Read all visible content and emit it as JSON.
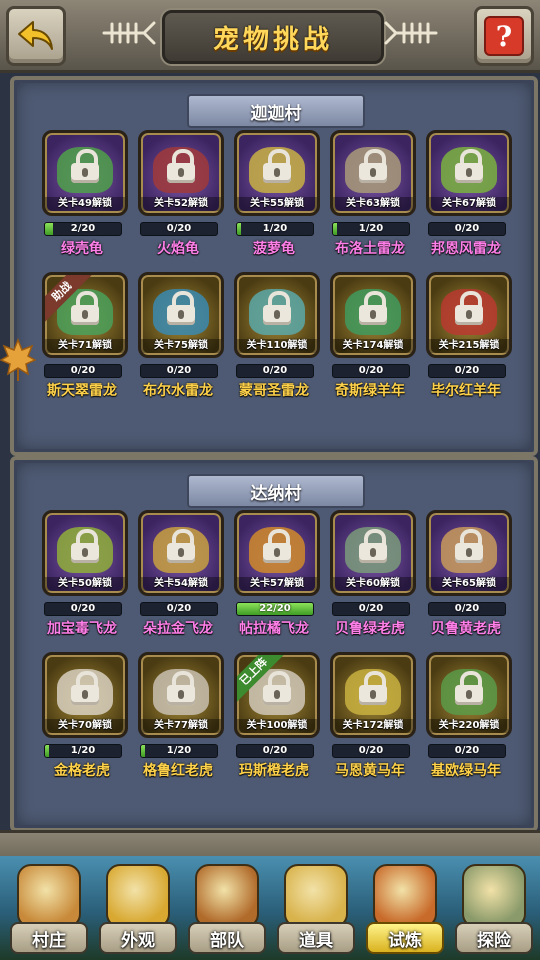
{
  "header": {
    "title": "宠物挑战",
    "help_glyph": "?"
  },
  "sections": [
    {
      "name": "迦迦村",
      "pets": [
        {
          "unlock": "关卡49解锁",
          "progress": "2/20",
          "fill": 0.1,
          "name": "绿壳龟",
          "name_color": "#ff7fe8",
          "card": "purple",
          "creature": "#4fa04a",
          "ribbon": ""
        },
        {
          "unlock": "关卡52解锁",
          "progress": "0/20",
          "fill": 0,
          "name": "火焰龟",
          "name_color": "#ff7fe8",
          "card": "purple",
          "creature": "#a03a3a",
          "ribbon": ""
        },
        {
          "unlock": "关卡55解锁",
          "progress": "1/20",
          "fill": 0.05,
          "name": "菠萝龟",
          "name_color": "#ff7fe8",
          "card": "purple",
          "creature": "#c8b044",
          "ribbon": ""
        },
        {
          "unlock": "关卡63解锁",
          "progress": "1/20",
          "fill": 0.05,
          "name": "布洛土雷龙",
          "name_color": "#ff7fe8",
          "card": "purple",
          "creature": "#a89a78",
          "ribbon": ""
        },
        {
          "unlock": "关卡67解锁",
          "progress": "0/20",
          "fill": 0,
          "name": "邦恩风雷龙",
          "name_color": "#ff7fe8",
          "card": "purple",
          "creature": "#7ab040",
          "ribbon": ""
        },
        {
          "unlock": "关卡71解锁",
          "progress": "0/20",
          "fill": 0,
          "name": "斯天翠雷龙",
          "name_color": "#ffd24a",
          "card": "gold",
          "creature": "#4aa05a",
          "ribbon": "助战"
        },
        {
          "unlock": "关卡75解锁",
          "progress": "0/20",
          "fill": 0,
          "name": "布尔水雷龙",
          "name_color": "#ffd24a",
          "card": "gold",
          "creature": "#3a8ab0",
          "ribbon": ""
        },
        {
          "unlock": "关卡110解锁",
          "progress": "0/20",
          "fill": 0,
          "name": "蒙哥圣雷龙",
          "name_color": "#ffd24a",
          "card": "gold",
          "creature": "#5aa8a8",
          "ribbon": ""
        },
        {
          "unlock": "关卡174解锁",
          "progress": "0/20",
          "fill": 0,
          "name": "奇斯绿羊年",
          "name_color": "#ffd24a",
          "card": "gold",
          "creature": "#3f9a5e",
          "ribbon": ""
        },
        {
          "unlock": "关卡215解锁",
          "progress": "0/20",
          "fill": 0,
          "name": "毕尔红羊年",
          "name_color": "#ffd24a",
          "card": "gold",
          "creature": "#b83a30",
          "ribbon": ""
        }
      ]
    },
    {
      "name": "达纳村",
      "pets": [
        {
          "unlock": "关卡50解锁",
          "progress": "0/20",
          "fill": 0,
          "name": "加宝毒飞龙",
          "name_color": "#ff7fe8",
          "card": "purple",
          "creature": "#8fae3a",
          "ribbon": ""
        },
        {
          "unlock": "关卡54解锁",
          "progress": "0/20",
          "fill": 0,
          "name": "朵拉金飞龙",
          "name_color": "#ff7fe8",
          "card": "purple",
          "creature": "#c8a040",
          "ribbon": ""
        },
        {
          "unlock": "关卡57解锁",
          "progress": "22/20",
          "fill": 1,
          "name": "帖拉橘飞龙",
          "name_color": "#ff7fe8",
          "card": "purple",
          "creature": "#d08a2a",
          "ribbon": ""
        },
        {
          "unlock": "关卡60解锁",
          "progress": "0/20",
          "fill": 0,
          "name": "贝鲁绿老虎",
          "name_color": "#ff7fe8",
          "card": "purple",
          "creature": "#7a9a7a",
          "ribbon": ""
        },
        {
          "unlock": "关卡65解锁",
          "progress": "0/20",
          "fill": 0,
          "name": "贝鲁黄老虎",
          "name_color": "#ff7fe8",
          "card": "purple",
          "creature": "#c89a5a",
          "ribbon": ""
        },
        {
          "unlock": "关卡70解锁",
          "progress": "1/20",
          "fill": 0.05,
          "name": "金格老虎",
          "name_color": "#ffd24a",
          "card": "gold",
          "creature": "#d8d0c0",
          "ribbon": ""
        },
        {
          "unlock": "关卡77解锁",
          "progress": "1/20",
          "fill": 0.05,
          "name": "格鲁红老虎",
          "name_color": "#ffd24a",
          "card": "gold",
          "creature": "#c8c0b0",
          "ribbon": ""
        },
        {
          "unlock": "关卡100解锁",
          "progress": "0/20",
          "fill": 0,
          "name": "玛斯橙老虎",
          "name_color": "#ffd24a",
          "card": "gold",
          "creature": "#d0c8b8",
          "ribbon": "已上阵"
        },
        {
          "unlock": "关卡172解锁",
          "progress": "0/20",
          "fill": 0,
          "name": "马恩黄马年",
          "name_color": "#ffd24a",
          "card": "gold",
          "creature": "#c8b040",
          "ribbon": ""
        },
        {
          "unlock": "关卡220解锁",
          "progress": "0/20",
          "fill": 0,
          "name": "基欧绿马年",
          "name_color": "#ffd24a",
          "card": "gold",
          "creature": "#5a9a48",
          "ribbon": ""
        }
      ]
    }
  ],
  "nav": [
    {
      "label": "村庄",
      "icon": "village-icon",
      "color": "#c88a3a",
      "active": false
    },
    {
      "label": "外观",
      "icon": "costume-icon",
      "color": "#d8a830",
      "active": false
    },
    {
      "label": "部队",
      "icon": "troops-icon",
      "color": "#b06a2a",
      "active": false
    },
    {
      "label": "道具",
      "icon": "items-icon",
      "color": "#d8b24a",
      "active": false
    },
    {
      "label": "试炼",
      "icon": "trial-icon",
      "color": "#c86a2a",
      "active": true
    },
    {
      "label": "探险",
      "icon": "explore-icon",
      "color": "#8a9a6a",
      "active": false
    }
  ]
}
